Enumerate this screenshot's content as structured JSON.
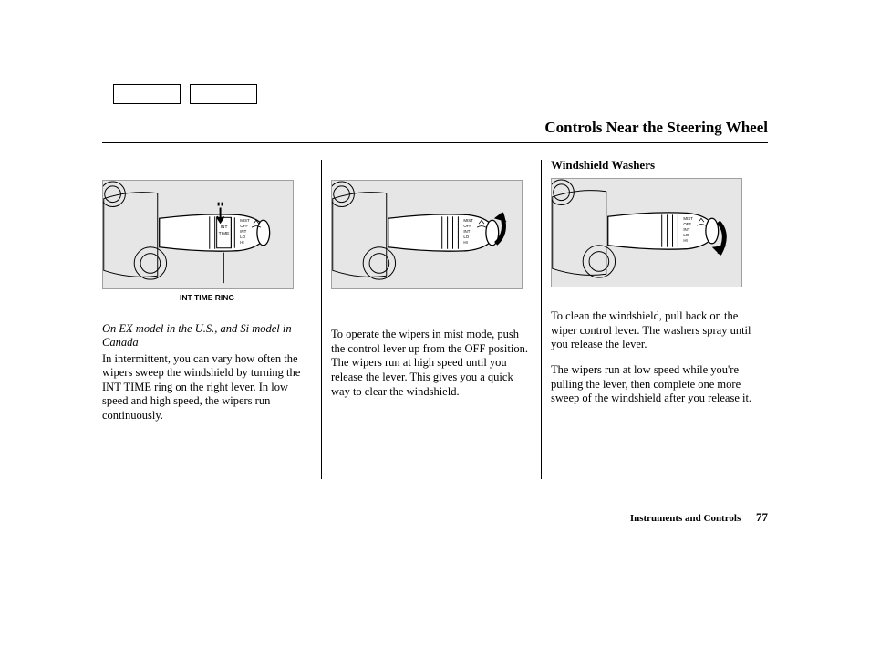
{
  "title": "Controls Near the Steering Wheel",
  "col1": {
    "caption": "INT TIME RING",
    "note": "On EX model in the U.S., and Si model in Canada",
    "p1": "In intermittent, you can vary how often the wipers sweep the windshield by turning the INT TIME ring on the right lever. In low speed and high speed, the wipers run continuously."
  },
  "col2": {
    "p1": "To operate the wipers in mist mode, push the control lever up from the OFF position. The wipers run at high speed until you release the lever. This gives you a quick way to clear the windshield."
  },
  "col3": {
    "heading": "Windshield Washers",
    "p1": "To clean the windshield, pull back on the wiper control lever. The washers spray until you release the lever.",
    "p2": "The wipers run at low speed while you're pulling the lever, then complete one more sweep of the windshield after you release it."
  },
  "footer": {
    "chapter": "Instruments and Controls",
    "page": "77"
  },
  "stalk_labels": {
    "l1": "MIST",
    "l2": "OFF",
    "l3": "INT",
    "l4": "LO",
    "l5": "HI",
    "int": "INT",
    "time": "TIME"
  }
}
